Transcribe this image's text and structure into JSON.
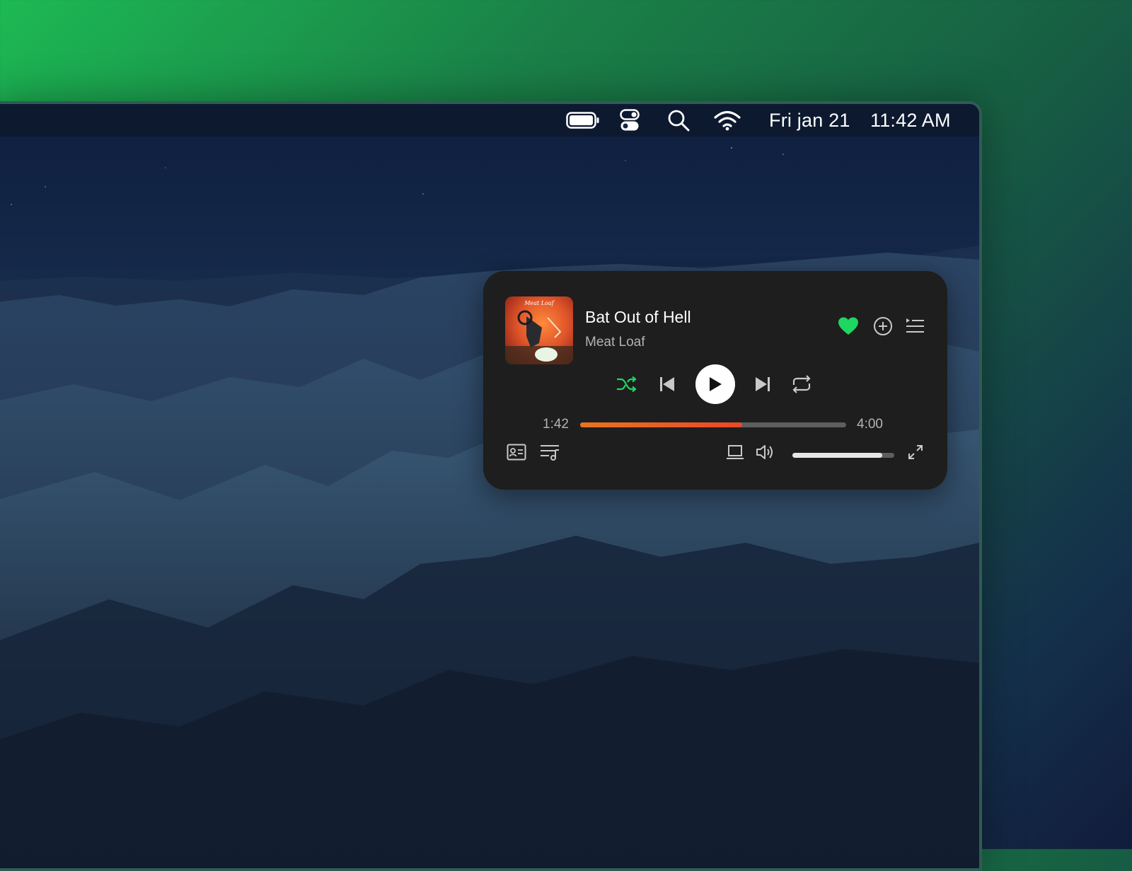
{
  "menubar": {
    "date": "Fri jan 21",
    "time": "11:42 AM",
    "icons": [
      "battery-icon",
      "control-center-icon",
      "search-icon",
      "wifi-icon"
    ]
  },
  "player": {
    "album_art": "Meat Loaf",
    "track_title": "Bat Out of Hell",
    "artist": "Meat Loaf",
    "liked": true,
    "elapsed": "1:42",
    "duration": "4:00",
    "progress_percent": 61,
    "volume_percent": 88,
    "shuffle_active": true,
    "colors": {
      "accent": "#1ed760",
      "progress_start": "#e8741f",
      "progress_end": "#e9482a",
      "background": "#1e1e1e"
    },
    "icons": [
      "heart-icon",
      "add-icon",
      "queue-icon",
      "shuffle-icon",
      "previous-icon",
      "play-icon",
      "next-icon",
      "repeat-icon",
      "now-playing-view-icon",
      "lyrics-icon",
      "device-icon",
      "volume-icon",
      "fullscreen-icon"
    ]
  }
}
